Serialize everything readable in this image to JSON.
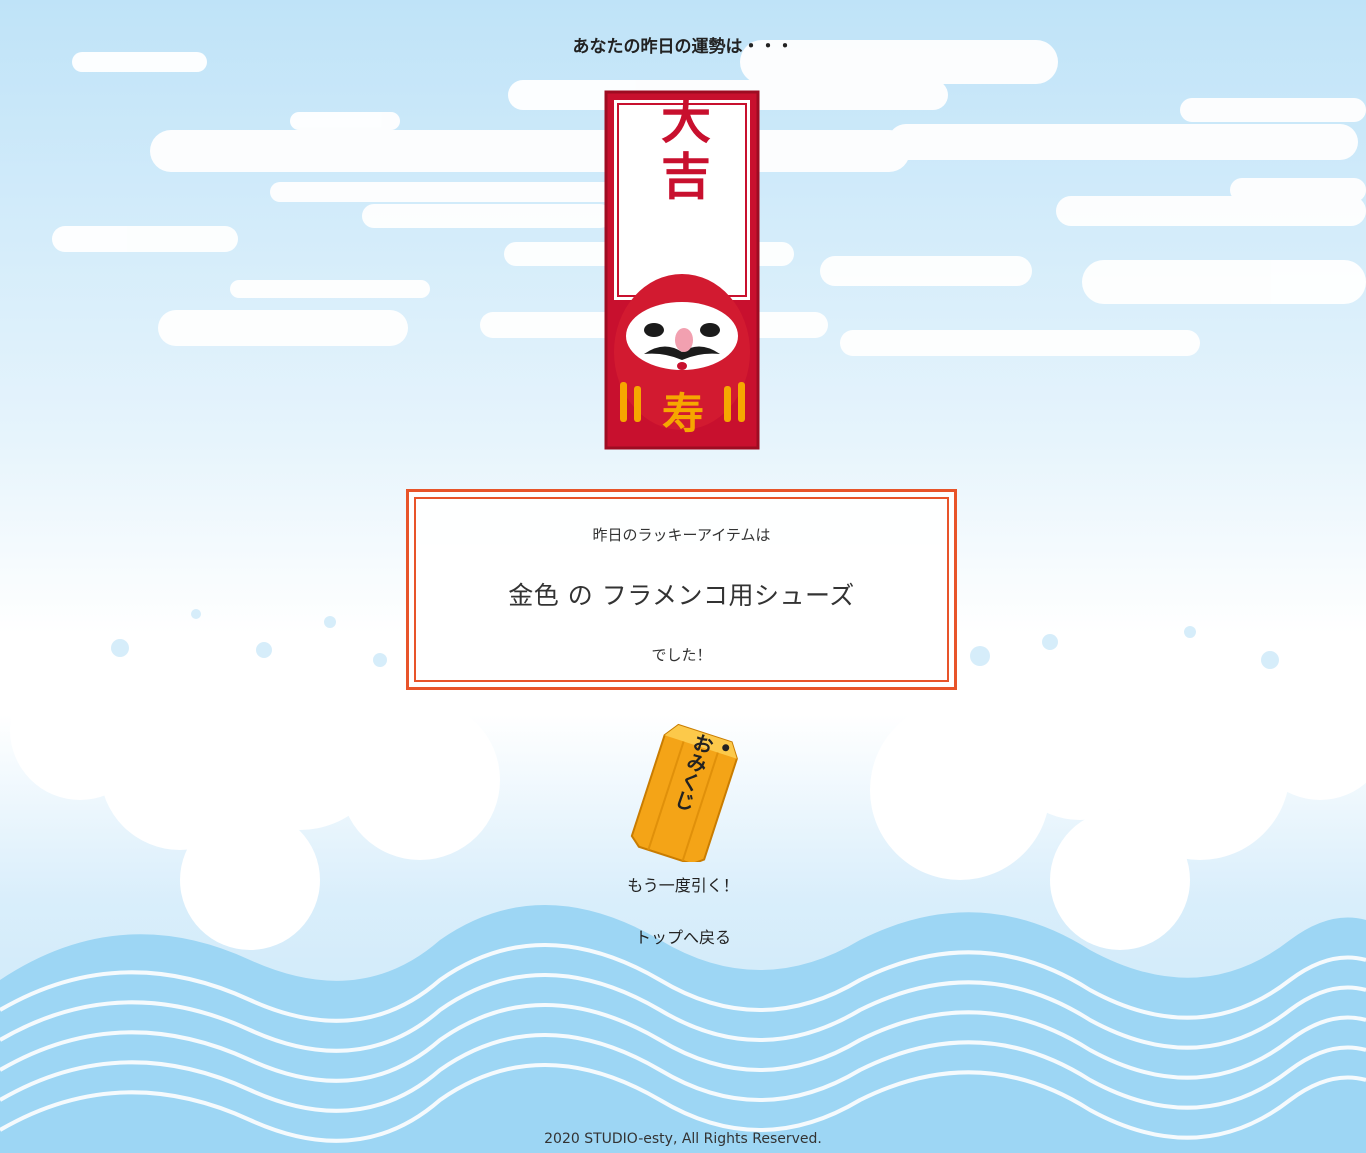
{
  "heading": "あなたの昨日の運勢は・・・",
  "fortune": {
    "rank": "大吉",
    "daruma_kanji": "寿"
  },
  "result": {
    "intro": "昨日のラッキーアイテムは",
    "item": "金色 の フラメンコ用シューズ",
    "outro": "でした！"
  },
  "omikuji_box": {
    "label": "おみくじ"
  },
  "actions": {
    "draw_again": "もう一度引く！",
    "back_to_top": "トップへ戻る"
  },
  "footer": "2020 STUDIO-esty, All Rights Reserved.",
  "colors": {
    "accent": "#e8542a",
    "slip_red": "#c8102e",
    "box_orange": "#f4a417",
    "sky": "#bfe3f8",
    "wave": "#8fd0f2"
  },
  "icons": {
    "omikuji_slip": "daikichi-daruma-slip",
    "omikuji_box": "omikuji-box-icon"
  }
}
